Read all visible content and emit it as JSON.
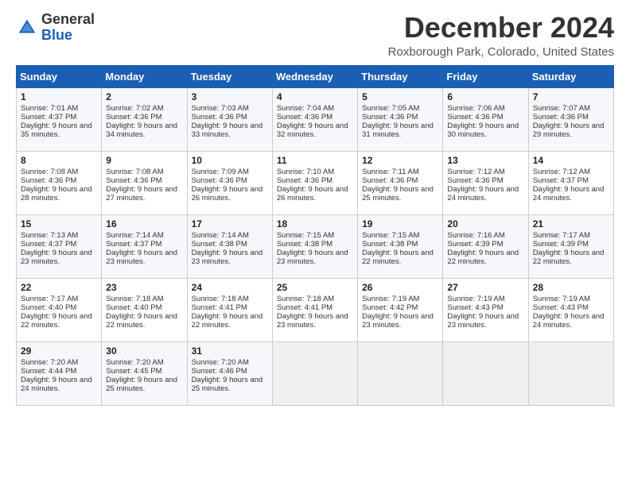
{
  "header": {
    "logo_line1": "General",
    "logo_line2": "Blue",
    "month_title": "December 2024",
    "location": "Roxborough Park, Colorado, United States"
  },
  "weekdays": [
    "Sunday",
    "Monday",
    "Tuesday",
    "Wednesday",
    "Thursday",
    "Friday",
    "Saturday"
  ],
  "weeks": [
    [
      {
        "day": "1",
        "sunrise": "Sunrise: 7:01 AM",
        "sunset": "Sunset: 4:37 PM",
        "daylight": "Daylight: 9 hours and 35 minutes."
      },
      {
        "day": "2",
        "sunrise": "Sunrise: 7:02 AM",
        "sunset": "Sunset: 4:36 PM",
        "daylight": "Daylight: 9 hours and 34 minutes."
      },
      {
        "day": "3",
        "sunrise": "Sunrise: 7:03 AM",
        "sunset": "Sunset: 4:36 PM",
        "daylight": "Daylight: 9 hours and 33 minutes."
      },
      {
        "day": "4",
        "sunrise": "Sunrise: 7:04 AM",
        "sunset": "Sunset: 4:36 PM",
        "daylight": "Daylight: 9 hours and 32 minutes."
      },
      {
        "day": "5",
        "sunrise": "Sunrise: 7:05 AM",
        "sunset": "Sunset: 4:36 PM",
        "daylight": "Daylight: 9 hours and 31 minutes."
      },
      {
        "day": "6",
        "sunrise": "Sunrise: 7:06 AM",
        "sunset": "Sunset: 4:36 PM",
        "daylight": "Daylight: 9 hours and 30 minutes."
      },
      {
        "day": "7",
        "sunrise": "Sunrise: 7:07 AM",
        "sunset": "Sunset: 4:36 PM",
        "daylight": "Daylight: 9 hours and 29 minutes."
      }
    ],
    [
      {
        "day": "8",
        "sunrise": "Sunrise: 7:08 AM",
        "sunset": "Sunset: 4:36 PM",
        "daylight": "Daylight: 9 hours and 28 minutes."
      },
      {
        "day": "9",
        "sunrise": "Sunrise: 7:08 AM",
        "sunset": "Sunset: 4:36 PM",
        "daylight": "Daylight: 9 hours and 27 minutes."
      },
      {
        "day": "10",
        "sunrise": "Sunrise: 7:09 AM",
        "sunset": "Sunset: 4:36 PM",
        "daylight": "Daylight: 9 hours and 26 minutes."
      },
      {
        "day": "11",
        "sunrise": "Sunrise: 7:10 AM",
        "sunset": "Sunset: 4:36 PM",
        "daylight": "Daylight: 9 hours and 26 minutes."
      },
      {
        "day": "12",
        "sunrise": "Sunrise: 7:11 AM",
        "sunset": "Sunset: 4:36 PM",
        "daylight": "Daylight: 9 hours and 25 minutes."
      },
      {
        "day": "13",
        "sunrise": "Sunrise: 7:12 AM",
        "sunset": "Sunset: 4:36 PM",
        "daylight": "Daylight: 9 hours and 24 minutes."
      },
      {
        "day": "14",
        "sunrise": "Sunrise: 7:12 AM",
        "sunset": "Sunset: 4:37 PM",
        "daylight": "Daylight: 9 hours and 24 minutes."
      }
    ],
    [
      {
        "day": "15",
        "sunrise": "Sunrise: 7:13 AM",
        "sunset": "Sunset: 4:37 PM",
        "daylight": "Daylight: 9 hours and 23 minutes."
      },
      {
        "day": "16",
        "sunrise": "Sunrise: 7:14 AM",
        "sunset": "Sunset: 4:37 PM",
        "daylight": "Daylight: 9 hours and 23 minutes."
      },
      {
        "day": "17",
        "sunrise": "Sunrise: 7:14 AM",
        "sunset": "Sunset: 4:38 PM",
        "daylight": "Daylight: 9 hours and 23 minutes."
      },
      {
        "day": "18",
        "sunrise": "Sunrise: 7:15 AM",
        "sunset": "Sunset: 4:38 PM",
        "daylight": "Daylight: 9 hours and 23 minutes."
      },
      {
        "day": "19",
        "sunrise": "Sunrise: 7:15 AM",
        "sunset": "Sunset: 4:38 PM",
        "daylight": "Daylight: 9 hours and 22 minutes."
      },
      {
        "day": "20",
        "sunrise": "Sunrise: 7:16 AM",
        "sunset": "Sunset: 4:39 PM",
        "daylight": "Daylight: 9 hours and 22 minutes."
      },
      {
        "day": "21",
        "sunrise": "Sunrise: 7:17 AM",
        "sunset": "Sunset: 4:39 PM",
        "daylight": "Daylight: 9 hours and 22 minutes."
      }
    ],
    [
      {
        "day": "22",
        "sunrise": "Sunrise: 7:17 AM",
        "sunset": "Sunset: 4:40 PM",
        "daylight": "Daylight: 9 hours and 22 minutes."
      },
      {
        "day": "23",
        "sunrise": "Sunrise: 7:18 AM",
        "sunset": "Sunset: 4:40 PM",
        "daylight": "Daylight: 9 hours and 22 minutes."
      },
      {
        "day": "24",
        "sunrise": "Sunrise: 7:18 AM",
        "sunset": "Sunset: 4:41 PM",
        "daylight": "Daylight: 9 hours and 22 minutes."
      },
      {
        "day": "25",
        "sunrise": "Sunrise: 7:18 AM",
        "sunset": "Sunset: 4:41 PM",
        "daylight": "Daylight: 9 hours and 23 minutes."
      },
      {
        "day": "26",
        "sunrise": "Sunrise: 7:19 AM",
        "sunset": "Sunset: 4:42 PM",
        "daylight": "Daylight: 9 hours and 23 minutes."
      },
      {
        "day": "27",
        "sunrise": "Sunrise: 7:19 AM",
        "sunset": "Sunset: 4:43 PM",
        "daylight": "Daylight: 9 hours and 23 minutes."
      },
      {
        "day": "28",
        "sunrise": "Sunrise: 7:19 AM",
        "sunset": "Sunset: 4:43 PM",
        "daylight": "Daylight: 9 hours and 24 minutes."
      }
    ],
    [
      {
        "day": "29",
        "sunrise": "Sunrise: 7:20 AM",
        "sunset": "Sunset: 4:44 PM",
        "daylight": "Daylight: 9 hours and 24 minutes."
      },
      {
        "day": "30",
        "sunrise": "Sunrise: 7:20 AM",
        "sunset": "Sunset: 4:45 PM",
        "daylight": "Daylight: 9 hours and 25 minutes."
      },
      {
        "day": "31",
        "sunrise": "Sunrise: 7:20 AM",
        "sunset": "Sunset: 4:46 PM",
        "daylight": "Daylight: 9 hours and 25 minutes."
      },
      null,
      null,
      null,
      null
    ]
  ]
}
